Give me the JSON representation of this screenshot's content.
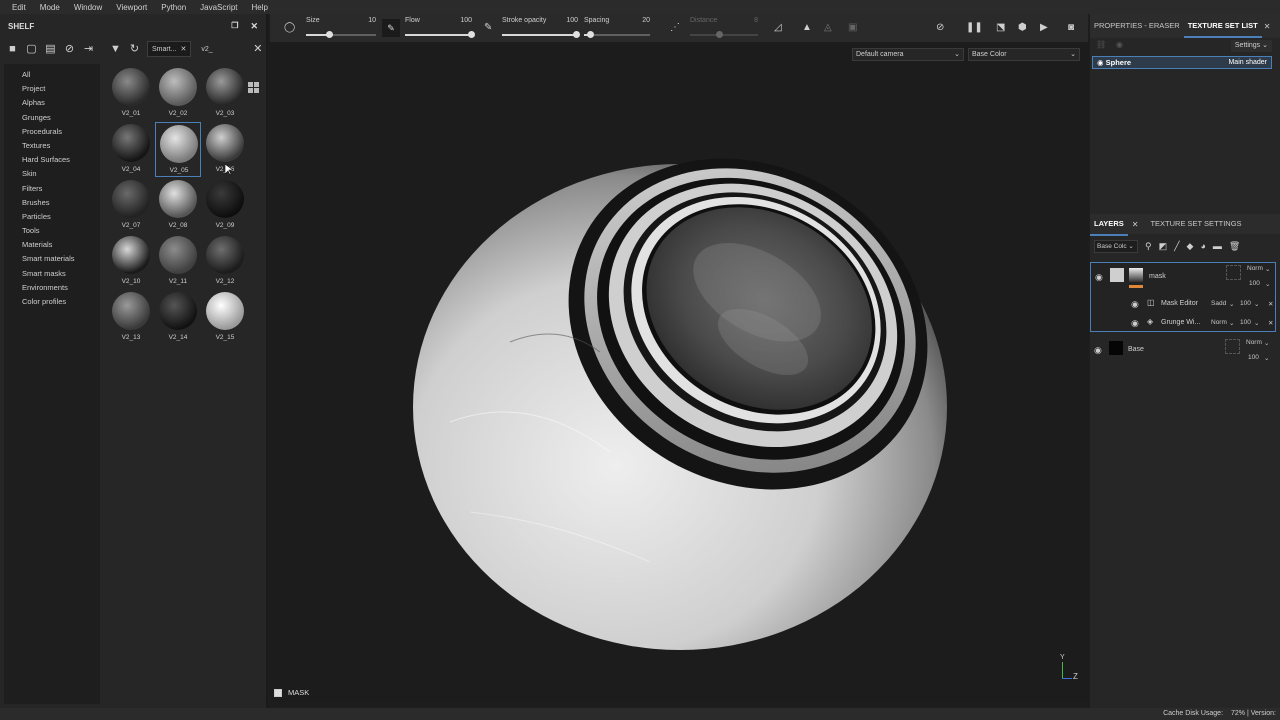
{
  "menu": [
    "Edit",
    "Mode",
    "Window",
    "Viewport",
    "Python",
    "JavaScript",
    "Help"
  ],
  "shelf": {
    "title": "SHELF",
    "search_tag": "Smart...",
    "search_value": "v2_",
    "categories": [
      "All",
      "Project",
      "Alphas",
      "Grunges",
      "Procedurals",
      "Textures",
      "Hard Surfaces",
      "Skin",
      "Filters",
      "Brushes",
      "Particles",
      "Tools",
      "Materials",
      "Smart materials",
      "Smart masks",
      "Environments",
      "Color profiles"
    ],
    "items": [
      "V2_01",
      "V2_02",
      "V2_03",
      "V2_04",
      "V2_05",
      "V2_06",
      "V2_07",
      "V2_08",
      "V2_09",
      "V2_10",
      "V2_11",
      "V2_12",
      "V2_13",
      "V2_14",
      "V2_15"
    ],
    "selected": "V2_05"
  },
  "toolbar": {
    "size_label": "Size",
    "size_value": "10",
    "flow_label": "Flow",
    "flow_value": "100",
    "stroke_label": "Stroke opacity",
    "stroke_value": "100",
    "spacing_label": "Spacing",
    "spacing_value": "20",
    "distance_label": "Distance",
    "distance_value": "8"
  },
  "viewport": {
    "camera": "Default camera",
    "channel": "Base Color",
    "mask_label": "MASK",
    "axis_y": "Y",
    "axis_z": "Z"
  },
  "properties": {
    "tab_properties": "PROPERTIES - ERASER",
    "tab_tsl": "TEXTURE SET LIST",
    "settings": "Settings",
    "texture_set": "Sphere",
    "shader": "Main shader"
  },
  "layers": {
    "tab_layers": "LAYERS",
    "tab_tss": "TEXTURE SET SETTINGS",
    "channel": "Base Colc",
    "rows": [
      {
        "name": "mask",
        "blend": "Norm",
        "opacity": "100"
      },
      {
        "name": "Mask Editor",
        "blend": "Sadd",
        "opacity": "100"
      },
      {
        "name": "Grunge Wi...",
        "blend": "Norm",
        "opacity": "100"
      },
      {
        "name": "Base",
        "blend": "Norm",
        "opacity": "100"
      }
    ]
  },
  "status": {
    "cache_label": "Cache Disk Usage:",
    "cache_value": "72%",
    "version_label": "| Version:"
  }
}
